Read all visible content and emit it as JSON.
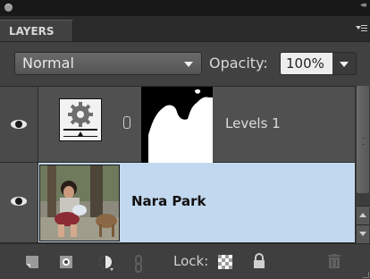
{
  "panel": {
    "tab_label": "LAYERS",
    "blend_mode": "Normal",
    "opacity_label": "Opacity:",
    "opacity_value": "100%",
    "lock_label": "Lock:"
  },
  "layers": [
    {
      "name": "Levels 1",
      "visible": true,
      "selected": false,
      "kind": "adjustment"
    },
    {
      "name": "Nara Park",
      "visible": true,
      "selected": true,
      "kind": "image"
    }
  ],
  "icons": {
    "panel_menu": "panel-menu-icon",
    "eye": "eye-icon",
    "adjustment": "adjustment-layer-icon",
    "link": "chain-link-icon",
    "new_layer": "new-layer-icon",
    "mask": "add-mask-icon",
    "new_adjustment": "new-adjustment-icon",
    "link_layers": "link-layers-icon",
    "lock_transparency": "lock-transparency-icon",
    "lock_all": "lock-icon",
    "delete": "trash-icon"
  },
  "colors": {
    "panel_bg": "#414141",
    "selected_row": "#c2d8ee",
    "row_bg": "#505050",
    "text_light": "#dcdcdc"
  }
}
